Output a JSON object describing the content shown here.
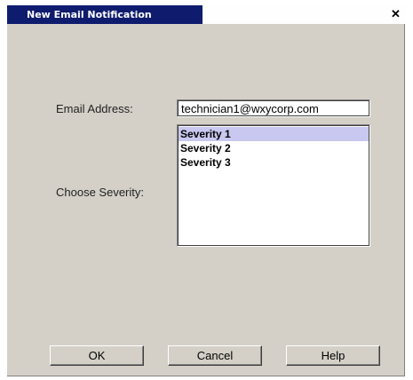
{
  "window": {
    "title": "New Email Notification",
    "close_glyph": "✕",
    "close_icon": "close-icon"
  },
  "form": {
    "email_label": "Email Address:",
    "email_value": "technician1@wxycorp.com",
    "severity_label": "Choose Severity:",
    "severity_options": [
      "Severity 1",
      "Severity 2",
      "Severity 3"
    ],
    "selected_index": 0
  },
  "buttons": {
    "ok": "OK",
    "cancel": "Cancel",
    "help": "Help"
  },
  "colors": {
    "title_bar": "#0f1c6e",
    "dialog_bg": "#d4d0c8",
    "selection": "#c8c8f0"
  }
}
